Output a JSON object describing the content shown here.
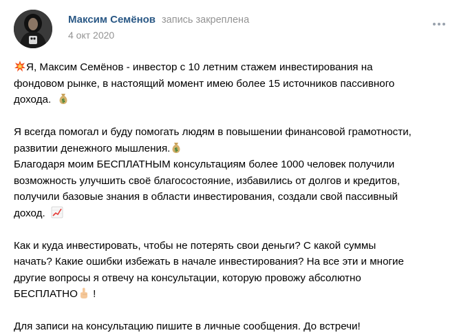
{
  "post": {
    "author": "Максим Семёнов",
    "pinned_label": "запись закреплена",
    "date": "4 окт 2020",
    "more_icon": "more-horizontal-icon"
  },
  "body": {
    "p1_line1": "Я, Максим Семёнов - инвестор с 10 летним стажем инвестирования на",
    "p1_line2": "фондовом рынке, в настоящий момент имею более 15 источников пассивного",
    "p1_line3": "дохода.",
    "p2_line1": "Я всегда помогал и буду помогать людям в повышении финансовой грамотности,",
    "p2_line2": "развитии денежного мышления.",
    "p3_line1": "Благодаря моим БЕСПЛАТНЫМ консультациям более 1000 человек получили",
    "p3_line2": "возможность улучшить своё благосостояние, избавились от долгов и кредитов,",
    "p3_line3": "получили базовые знания в области инвестирования, создали свой пассивный",
    "p3_line4": "доход.",
    "p4_line1": "Как и куда инвестировать, чтобы не потерять свои деньги? С какой суммы",
    "p4_line2": "начать? Какие ошибки избежать в начале инвестирования? На все эти и многие",
    "p4_line3": "другие вопросы я отвечу на консультации, которую провожу абсолютно",
    "p4_line4a": "БЕСПЛАТНО",
    "p4_line4b": " !",
    "p5_line1": "Для записи на консультацию пишите в личные сообщения. До встречи!"
  },
  "colors": {
    "author": "#2a5885",
    "meta": "#939393",
    "text": "#000000"
  }
}
